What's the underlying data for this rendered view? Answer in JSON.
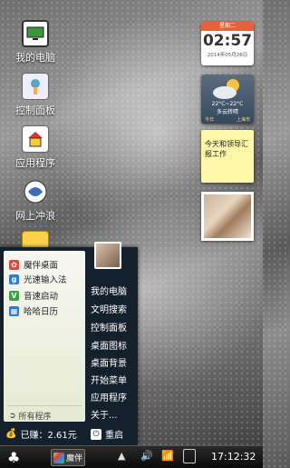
{
  "desktop": {
    "icons": [
      {
        "label": "我的电脑",
        "icon": "computer-icon"
      },
      {
        "label": "控制面板",
        "icon": "control-panel-icon"
      },
      {
        "label": "应用程序",
        "icon": "applications-icon"
      },
      {
        "label": "网上冲浪",
        "icon": "browser-icon"
      },
      {
        "label": "",
        "icon": "folder-icon"
      }
    ]
  },
  "widgets": {
    "clock": {
      "day": "星期二",
      "time": "02:57",
      "date": "2014年05月26日"
    },
    "weather": {
      "temp": "22°C~22°C",
      "desc": "多云转晴",
      "today": "今日",
      "city": "上海市"
    },
    "note": {
      "text": "今天和领导汇报工作"
    }
  },
  "start_menu": {
    "left_items": [
      {
        "label": "魔伴桌面",
        "icon": "mobanz-icon",
        "color": "#e04a3c"
      },
      {
        "label": "光速输入法",
        "icon": "keyboard-icon",
        "color": "#2b7fd8"
      },
      {
        "label": "音速启动",
        "icon": "launcher-icon",
        "color": "#3aa04a"
      },
      {
        "label": "哈哈日历",
        "icon": "calendar-icon",
        "color": "#2f7ad0"
      }
    ],
    "all_programs": "所有程序",
    "right_items": [
      "我的电脑",
      "文明搜索",
      "控制面板",
      "桌面图标",
      "桌面背景",
      "开始菜单",
      "应用程序",
      "关于..."
    ],
    "earnings": "已赚：2.61元",
    "restart": "重启"
  },
  "taskbar": {
    "app_label": "魔伴",
    "clock": "17:12:32"
  }
}
